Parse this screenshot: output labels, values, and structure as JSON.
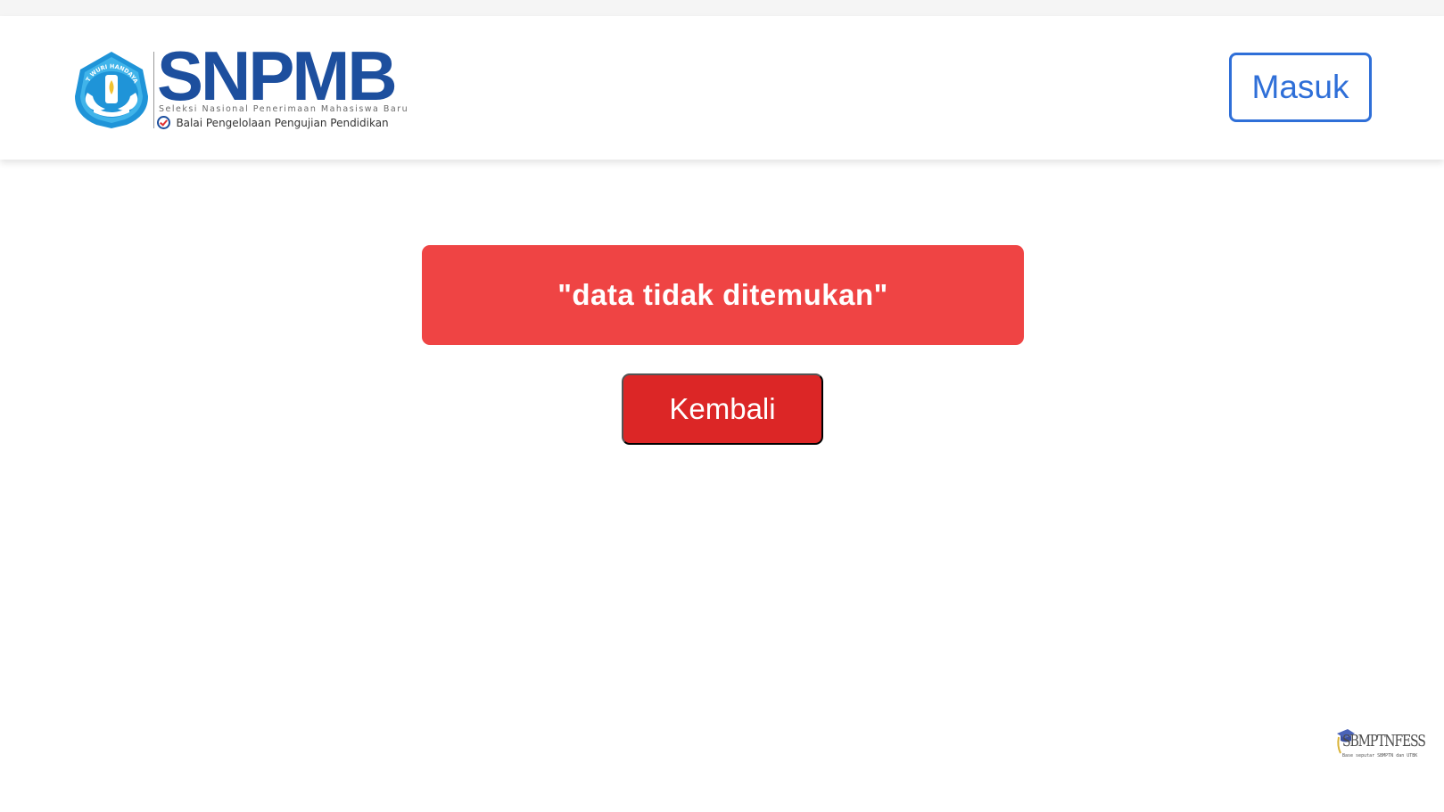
{
  "header": {
    "logo": {
      "wordmark": "SNPMB",
      "tagline": "Seleksi Nasional Penerimaan Mahasiswa Baru",
      "org": "Balai Pengelolaan Pengujian Pendidikan",
      "emblem_text": "TUT WURI HANDAYANI",
      "emblem_icon": "tut-wuri-handayani-emblem",
      "brand_color": "#1d4f9e"
    },
    "login_button": "Masuk",
    "login_button_color": "#2f6fd8"
  },
  "main": {
    "alert_message": "\"data tidak ditemukan\"",
    "alert_color": "#ef4444",
    "back_button": "Kembali",
    "back_button_color": "#dc2626"
  },
  "watermark": {
    "title": "SBMPTNFESS",
    "subtitle": "Base seputar SBMPTN dan UTBK"
  }
}
